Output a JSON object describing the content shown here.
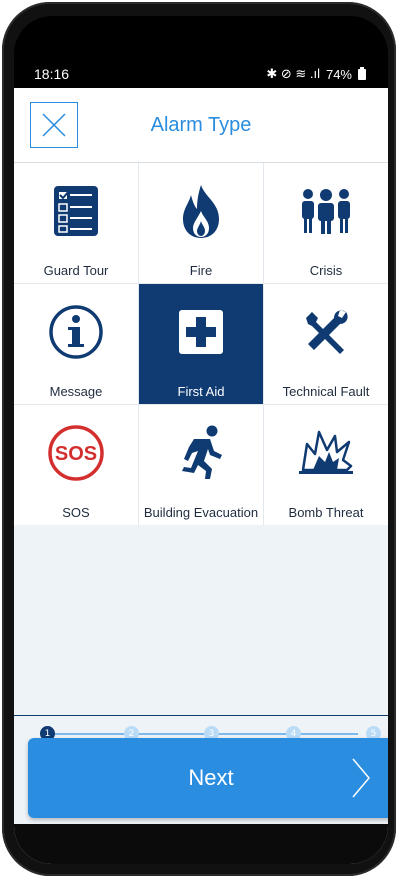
{
  "status": {
    "time": "18:16",
    "icons_text": "✱ ⊘ ≋ .ıl",
    "battery": "74%"
  },
  "header": {
    "title": "Alarm Type",
    "close_icon": "close-icon"
  },
  "tiles": [
    {
      "label": "Guard Tour",
      "icon": "checklist-icon",
      "selected": false
    },
    {
      "label": "Fire",
      "icon": "fire-icon",
      "selected": false
    },
    {
      "label": "Crisis",
      "icon": "crowd-icon",
      "selected": false
    },
    {
      "label": "Message",
      "icon": "info-icon",
      "selected": false
    },
    {
      "label": "First Aid",
      "icon": "first-aid-icon",
      "selected": true
    },
    {
      "label": "Technical Fault",
      "icon": "tools-icon",
      "selected": false
    },
    {
      "label": "SOS",
      "icon": "sos-icon",
      "selected": false
    },
    {
      "label": "Building Evacuation",
      "icon": "running-person-icon",
      "selected": false
    },
    {
      "label": "Bomb Threat",
      "icon": "explosion-icon",
      "selected": false
    }
  ],
  "steps": {
    "labels": [
      "1",
      "2",
      "3",
      "4",
      "5"
    ],
    "current": 1
  },
  "next_button": {
    "label": "Next"
  },
  "colors": {
    "accent": "#2a8de0",
    "navy": "#0f3a72",
    "sos_red": "#d32f2f"
  }
}
